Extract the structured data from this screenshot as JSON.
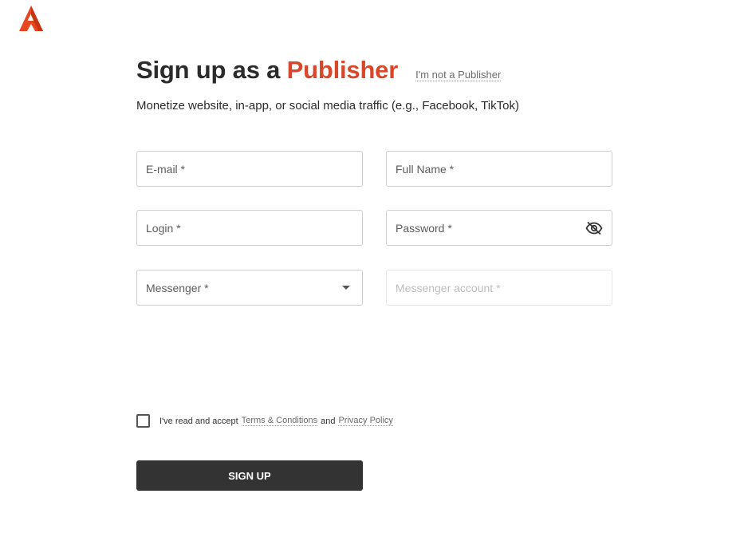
{
  "brand": {
    "logo_icon": "brand-a-logo-icon",
    "accent_color": "#d9472b"
  },
  "header": {
    "title_prefix": "Sign up as a",
    "title_accent": "Publisher",
    "not_publisher_link": "I'm not a Publisher",
    "subtitle": "Monetize website, in-app, or social media traffic (e.g., Facebook, TikTok)"
  },
  "form": {
    "email_placeholder": "E-mail *",
    "full_name_placeholder": "Full Name *",
    "login_placeholder": "Login *",
    "password_placeholder": "Password *",
    "password_toggle_icon": "eye-off-icon",
    "messenger_placeholder": "Messenger *",
    "messenger_account_placeholder": "Messenger account *"
  },
  "consent": {
    "prefix": "I've read and accept",
    "terms_link": "Terms & Conditions",
    "and": "and",
    "privacy_link": "Privacy Policy",
    "checked": false
  },
  "submit": {
    "label": "SIGN UP",
    "color": "#333333"
  }
}
